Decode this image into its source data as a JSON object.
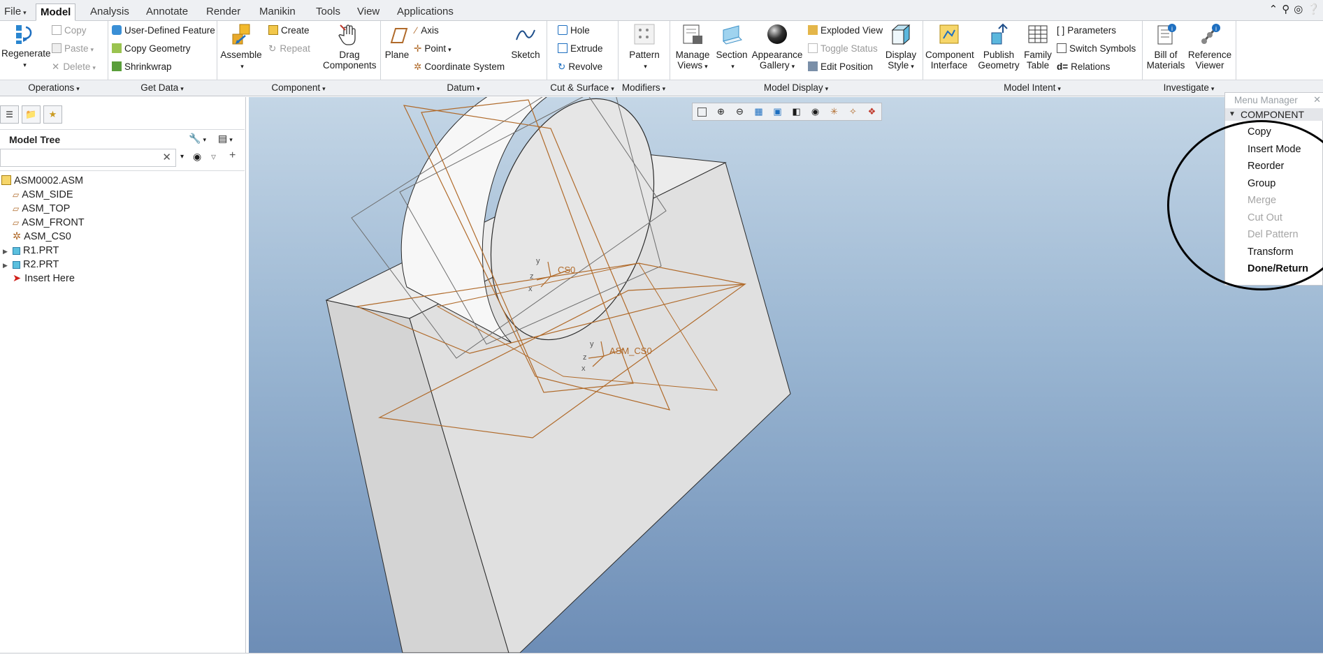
{
  "tabs": {
    "file": "File",
    "items": [
      "Model",
      "Analysis",
      "Annotate",
      "Render",
      "Manikin",
      "Tools",
      "View",
      "Applications"
    ],
    "active": "Model"
  },
  "ribbon": {
    "operations": {
      "regenerate": "Regenerate",
      "copy": "Copy",
      "paste": "Paste",
      "delete": "Delete"
    },
    "get_data": {
      "udf": "User-Defined Feature",
      "copy_geometry": "Copy Geometry",
      "shrinkwrap": "Shrinkwrap"
    },
    "component": {
      "assemble": "Assemble",
      "create": "Create",
      "repeat": "Repeat",
      "drag_components": "Drag Components"
    },
    "datum": {
      "plane": "Plane",
      "axis": "Axis",
      "point": "Point",
      "coordinate_system": "Coordinate System",
      "sketch": "Sketch"
    },
    "cut_surface": {
      "hole": "Hole",
      "extrude": "Extrude",
      "revolve": "Revolve"
    },
    "modifiers": {
      "pattern": "Pattern"
    },
    "model_display": {
      "manage_views": "Manage Views",
      "section": "Section",
      "appearance_gallery": "Appearance Gallery",
      "exploded_view": "Exploded View",
      "toggle_status": "Toggle Status",
      "edit_position": "Edit Position",
      "display_style": "Display Style"
    },
    "model_intent": {
      "component_interface": "Component Interface",
      "publish_geometry": "Publish Geometry",
      "family_table": "Family Table",
      "parameters": "Parameters",
      "switch_symbols": "Switch Symbols",
      "relations": "Relations"
    },
    "investigate": {
      "bill_of_materials": "Bill of Materials",
      "reference_viewer": "Reference Viewer"
    }
  },
  "groups": [
    "Operations",
    "Get Data",
    "Component",
    "Datum",
    "Cut & Surface",
    "Modifiers",
    "Model Display",
    "Model Intent",
    "Investigate"
  ],
  "model_tree": {
    "title": "Model Tree",
    "search_value": "",
    "nodes": [
      {
        "label": "ASM0002.ASM",
        "icon": "assembly-icon"
      },
      {
        "label": "ASM_SIDE",
        "icon": "datum-plane-icon"
      },
      {
        "label": "ASM_TOP",
        "icon": "datum-plane-icon"
      },
      {
        "label": "ASM_FRONT",
        "icon": "datum-plane-icon"
      },
      {
        "label": "ASM_CS0",
        "icon": "coordinate-system-icon"
      },
      {
        "label": "R1.PRT",
        "icon": "part-icon"
      },
      {
        "label": "R2.PRT",
        "icon": "part-icon"
      },
      {
        "label": "Insert Here",
        "icon": "insert-arrow-icon"
      }
    ]
  },
  "viewport": {
    "labels": {
      "cs0": "CS0",
      "asm_cs0": "ASM_CS0",
      "axis_y": "y",
      "axis_z": "z",
      "axis_x": "x"
    }
  },
  "menu_manager": {
    "title": "Menu Manager",
    "section": "COMPONENT",
    "items": [
      {
        "label": "Copy",
        "enabled": true,
        "bold": false
      },
      {
        "label": "Insert Mode",
        "enabled": true,
        "bold": false
      },
      {
        "label": "Reorder",
        "enabled": true,
        "bold": false
      },
      {
        "label": "Group",
        "enabled": true,
        "bold": false
      },
      {
        "label": "Merge",
        "enabled": false,
        "bold": false
      },
      {
        "label": "Cut Out",
        "enabled": false,
        "bold": false
      },
      {
        "label": "Del Pattern",
        "enabled": false,
        "bold": false
      },
      {
        "label": "Transform",
        "enabled": true,
        "bold": false
      },
      {
        "label": "Done/Return",
        "enabled": true,
        "bold": true
      }
    ]
  },
  "colors": {
    "datum_orange": "#b06a2a",
    "viewport_top": "#c4d6e6",
    "viewport_bottom": "#6d8db6",
    "accent_blue": "#1e6fc0"
  }
}
